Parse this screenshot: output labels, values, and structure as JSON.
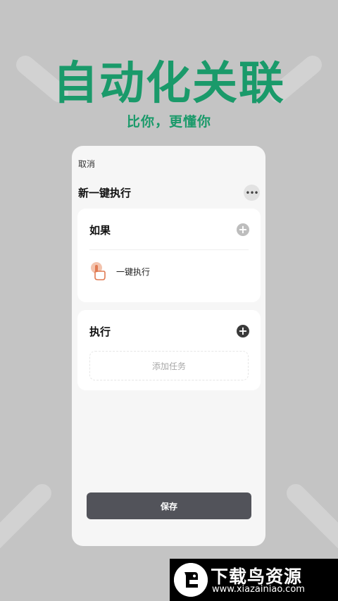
{
  "promo": {
    "headline": "自动化关联",
    "subline": "比你，更懂你"
  },
  "screen": {
    "cancel_label": "取消",
    "scene_title": "新一键执行",
    "more_icon": "more-horizontal-icon",
    "if_card": {
      "heading": "如果",
      "add_icon": "plus-circle-icon",
      "condition": {
        "icon": "hand-tap-icon",
        "label": "一键执行"
      }
    },
    "do_card": {
      "heading": "执行",
      "add_icon": "plus-circle-icon",
      "add_task_label": "添加任务"
    },
    "save_label": "保存"
  },
  "watermark": {
    "title": "下载鸟资源",
    "url": "www.xiazainiao.com"
  },
  "colors": {
    "background": "#c4c4c4",
    "accent_green": "#1a9a6a",
    "save_button": "#52535a",
    "condition_icon": "#e07a52"
  }
}
